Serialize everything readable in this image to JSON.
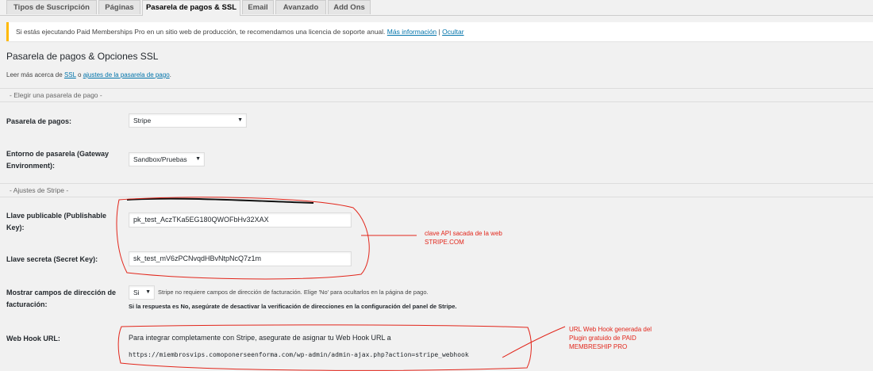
{
  "tabs": [
    {
      "label": "Tipos de Suscripción"
    },
    {
      "label": "Páginas"
    },
    {
      "label": "Pasarela de pagos & SSL"
    },
    {
      "label": "Email"
    },
    {
      "label": "Avanzado"
    },
    {
      "label": "Add Ons"
    }
  ],
  "notice": {
    "text": "Si estás ejecutando Paid Memberships Pro en un sitio web de producción, te recomendamos una licencia de soporte anual.",
    "more_link": "Más información",
    "separator": "|",
    "hide_link": "Ocultar"
  },
  "page_title": "Pasarela de pagos & Opciones SSL",
  "intro": {
    "prefix": "Leer más acerca de",
    "ssl_link": "SSL",
    "middle": "o",
    "settings_link": "ajustes de la pasarela de pago",
    "suffix": "."
  },
  "sections": {
    "choose_gateway": "- Elegir una pasarela de pago -",
    "stripe_settings": "- Ajustes de Stripe -"
  },
  "fields": {
    "gateway": {
      "label": "Pasarela de pagos:",
      "value": "Stripe"
    },
    "environment": {
      "label": "Entorno de pasarela (Gateway Environment):",
      "value": "Sandbox/Pruebas"
    },
    "publishable_key": {
      "label": "Llave publicable (Publishable Key):",
      "value": "pk_test_AczTKa5EG180QWOFbHv32XAX"
    },
    "secret_key": {
      "label": "Llave secreta (Secret Key):",
      "value": "sk_test_mV6zPCNvqdHBvNtpNcQ7z1m"
    },
    "billing_address": {
      "label": "Mostrar campos de dirección de facturación:",
      "value": "Si",
      "hint": "Stripe no requiere campos de dirección de facturación. Elige 'No' para ocultarlos en la página de pago.",
      "note": "Si la respuesta es No, asegúrate de desactivar la verificación de direcciones en la configuración del panel de Stripe."
    },
    "webhook": {
      "label": "Web Hook URL:",
      "text": "Para integrar completamente con Stripe, asegurate de asignar tu Web Hook URL a",
      "url": "https://miembrosvips.comoponerseenforma.com/wp-admin/admin-ajax.php?action=stripe_webhook"
    }
  },
  "annotations": {
    "api_key": "clave API sacada de la web STRIPE.COM",
    "webhook": "URL  Web Hook generada del Plugin gratuido de PAID MEMBRESHIP PRO"
  },
  "colors": {
    "annotation": "#e2261b",
    "link": "#0073aa",
    "notice_border": "#ffb900"
  }
}
